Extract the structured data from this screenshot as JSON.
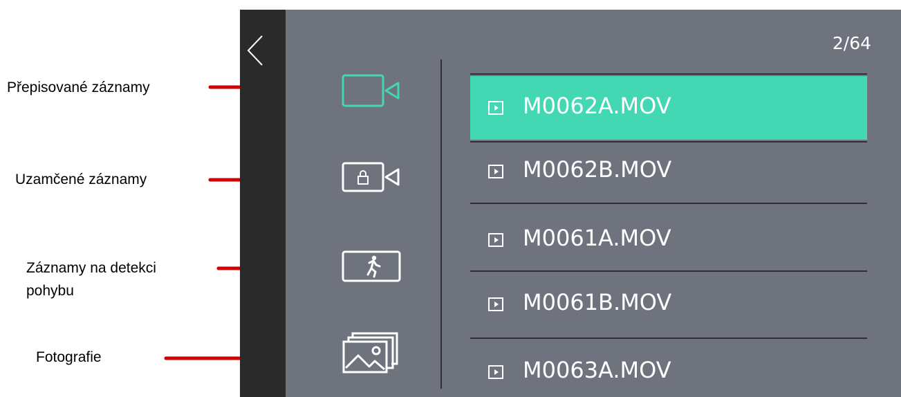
{
  "annotations": [
    {
      "label": "Přepisované záznamy"
    },
    {
      "label": "Uzamčené záznamy"
    },
    {
      "label": "Záznamy na detekci"
    },
    {
      "label": "pohybu"
    },
    {
      "label": "Fotografie"
    }
  ],
  "colors": {
    "accent": "#44d7b4",
    "screen_bg": "#6f737d",
    "strip_bg": "#2a2a2a",
    "arrow": "#cc0000"
  },
  "header": {
    "counter": "2/64"
  },
  "categories": [
    {
      "icon": "video-camera-icon",
      "active": true
    },
    {
      "icon": "locked-video-icon",
      "active": false
    },
    {
      "icon": "motion-detection-icon",
      "active": false
    },
    {
      "icon": "photos-icon",
      "active": false
    }
  ],
  "files": [
    {
      "name": "M0062A.MOV",
      "selected": true,
      "icon": "play-icon"
    },
    {
      "name": "M0062B.MOV",
      "selected": false,
      "icon": "play-icon"
    },
    {
      "name": "M0061A.MOV",
      "selected": false,
      "icon": "play-icon"
    },
    {
      "name": "M0061B.MOV",
      "selected": false,
      "icon": "play-icon"
    },
    {
      "name": "M0063A.MOV",
      "selected": false,
      "icon": "play-icon"
    }
  ]
}
